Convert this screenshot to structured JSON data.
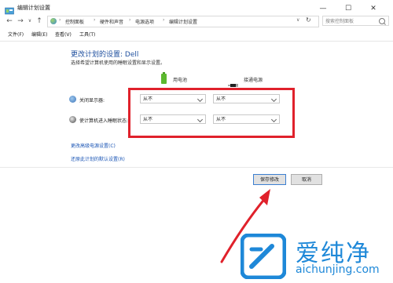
{
  "window": {
    "title": "编辑计划设置",
    "controls": {
      "minimize": "—",
      "maximize": "☐",
      "close": "✕"
    }
  },
  "nav": {
    "back": "←",
    "forward": "→",
    "recent": "∨",
    "up": "↑"
  },
  "breadcrumb": [
    "控制面板",
    "硬件和声音",
    "电源选项",
    "编辑计划设置"
  ],
  "search": {
    "placeholder": "搜索控制面板"
  },
  "menu": [
    "文件(F)",
    "编辑(E)",
    "查看(V)",
    "工具(T)"
  ],
  "content": {
    "heading": "更改计划的设置: Dell",
    "subtext": "选择希望计算机使用的睡眠设置和显示设置。",
    "columns": {
      "battery": "用电池",
      "plugged": "接通电源"
    },
    "rows": [
      {
        "label": "关闭显示器:",
        "battery": "从不",
        "plugged": "从不",
        "icon": "monitor-icon"
      },
      {
        "label": "使计算机进入睡眠状态:",
        "battery": "从不",
        "plugged": "从不",
        "icon": "moon-icon"
      }
    ],
    "links": [
      "更改高级电源设置(C)",
      "还原此计划的默认设置(R)"
    ]
  },
  "buttons": {
    "save": "保存修改",
    "cancel": "取消"
  },
  "watermark": {
    "brand": "爱纯净",
    "url": "aichunjing.com"
  },
  "colors": {
    "highlight": "#e0212b",
    "link": "#1a55b5",
    "brand": "#1e88d8"
  }
}
